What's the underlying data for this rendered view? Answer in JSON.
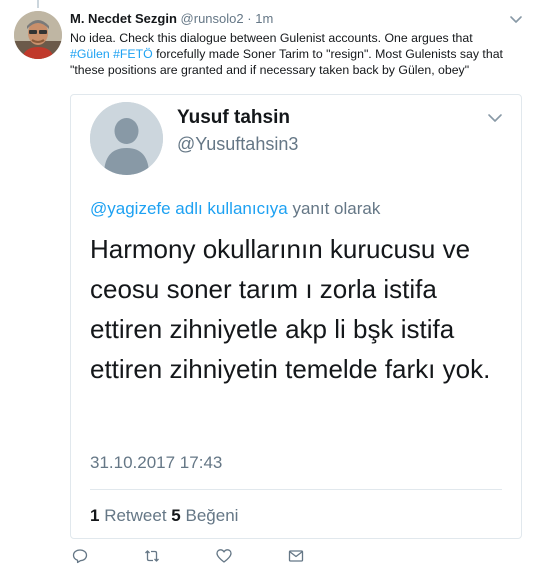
{
  "tweet": {
    "author_name": "M. Necdet Sezgin",
    "author_handle": "@runsolo2",
    "separator": "·",
    "time": "1m",
    "text_1": "No idea. Check this dialogue between Gulenist accounts. One argues that ",
    "hashtag_1": "#Gülen",
    "space": " ",
    "hashtag_2": "#FETÖ",
    "text_2": " forcefully made Soner Tarim to \"resign\". Most Gulenists say that \"these positions are granted and if necessary taken back by Gülen, obey\""
  },
  "quoted": {
    "author_name": "Yusuf tahsin",
    "author_handle": "@Yusuftahsin3",
    "reply_mention": "@yagizefe adlı kullanıcıya",
    "reply_suffix": " yanıt olarak",
    "body": "Harmony okullarının kurucusu ve ceosu soner tarım ı zorla istifa ettiren zihniyetle akp li bşk istifa ettiren zihniyetin temelde farkı yok.",
    "date": "31.10.2017 17:43",
    "retweet_count": "1",
    "retweet_label": " Retweet",
    "like_count": "5",
    "like_label": " Beğeni"
  },
  "icons": {
    "reply": "reply-icon",
    "retweet": "retweet-icon",
    "like": "heart-icon",
    "message": "mail-icon",
    "caret": "chevron-down-icon"
  },
  "colors": {
    "link": "#1da1f2",
    "secondary_text": "#657786",
    "primary_text": "#14171a",
    "border": "#e1e8ed"
  }
}
